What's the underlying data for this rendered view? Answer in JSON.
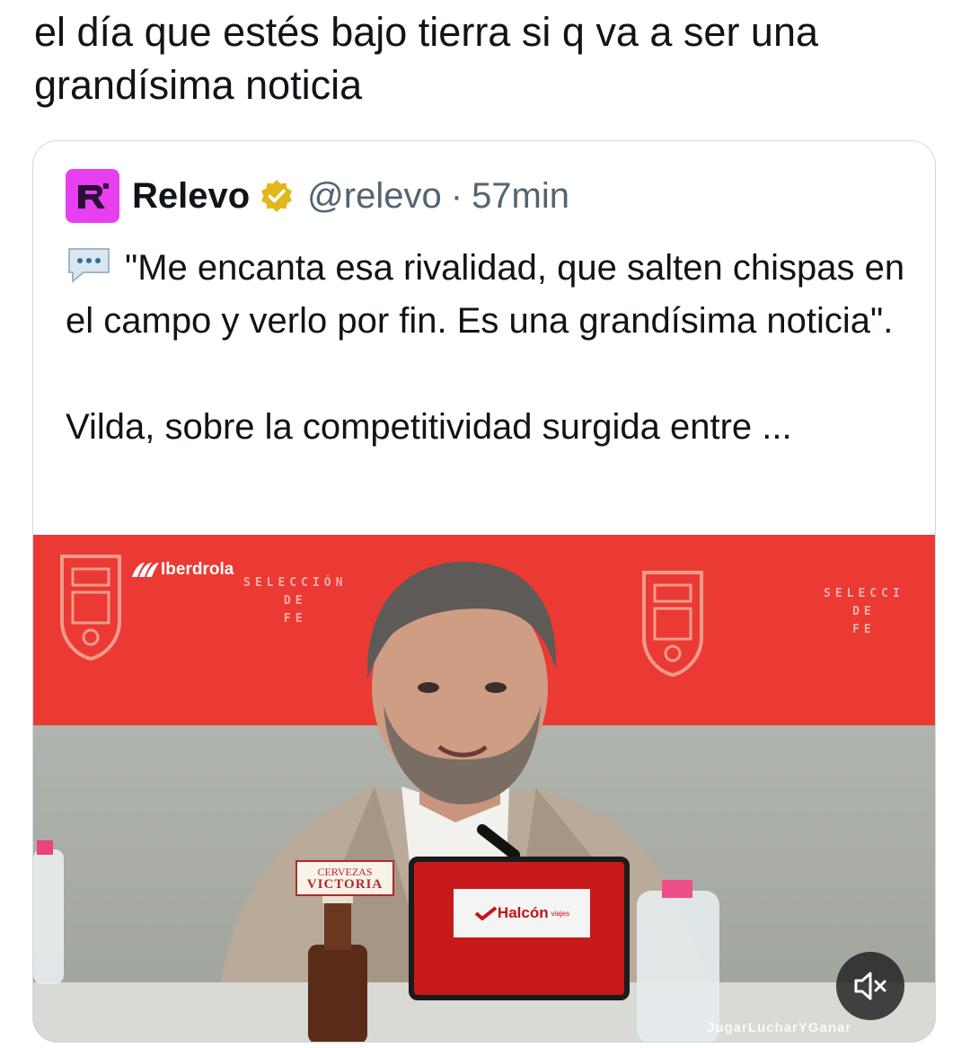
{
  "post": {
    "text": "el día que estés bajo tierra si q va a ser una grandísima noticia"
  },
  "quoted_tweet": {
    "display_name": "Relevo",
    "handle": "@relevo",
    "separator": "·",
    "time": "57min",
    "body_line1": "\"Me encanta esa rivalidad, que salten chispas en el campo y verlo por fin. Es una grandísima noticia\".",
    "body_line2": "Vilda, sobre la competitividad surgida entre ...",
    "avatar_letter": "R",
    "avatar_color": "#e83ff0",
    "verified_color": "#e2b719"
  },
  "media": {
    "sponsor_left": "Iberdrola",
    "backdrop_text_1": "SELECCIÓN\nDE\nFE",
    "backdrop_text_2": "SELECCI\nDE\nFE",
    "mic_sponsor": "Halcón",
    "mic_sponsor_small": "viajes",
    "beer_line1": "CERVEZAS",
    "beer_line2": "VICTORIA",
    "watermark": "JugarLucharYGanar",
    "mute_icon": "speaker-muted-icon"
  },
  "colors": {
    "text": "#0f1419",
    "secondary": "#536471",
    "border": "#cfd9de",
    "backdrop_red": "#ea3a33"
  }
}
